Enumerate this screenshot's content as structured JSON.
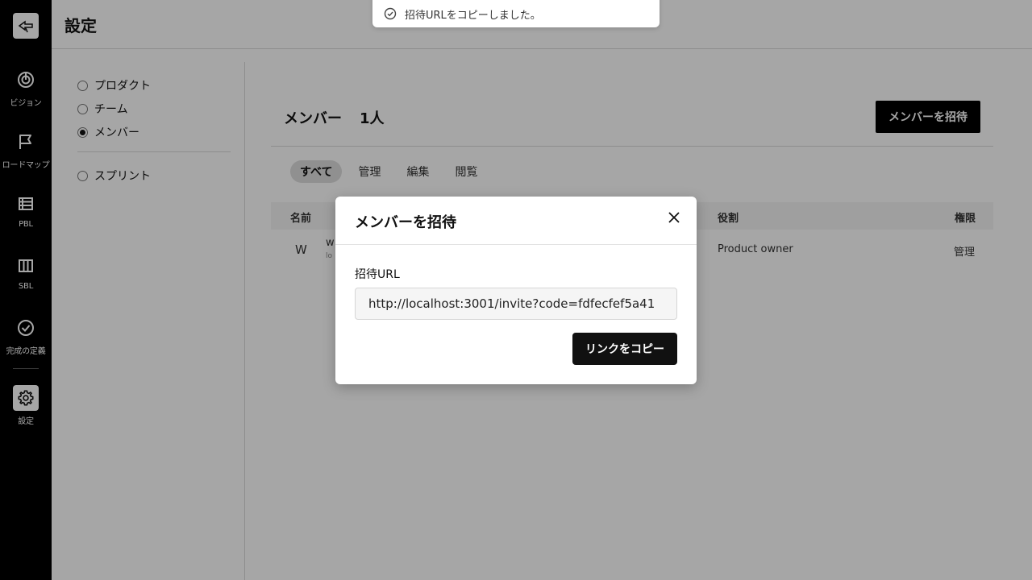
{
  "rail": {
    "items": [
      {
        "label": "ビジョン",
        "icon": "target-icon"
      },
      {
        "label": "ロードマップ",
        "icon": "flag-icon"
      },
      {
        "label": "PBL",
        "icon": "list-icon"
      },
      {
        "label": "SBL",
        "icon": "columns-icon"
      },
      {
        "label": "完成の定義",
        "icon": "check-circle-icon"
      },
      {
        "label": "設定",
        "icon": "gear-icon"
      }
    ]
  },
  "header": {
    "title": "設定"
  },
  "settings_nav": {
    "items": [
      {
        "label": "プロダクト",
        "checked": false
      },
      {
        "label": "チーム",
        "checked": false
      },
      {
        "label": "メンバー",
        "checked": true
      },
      {
        "label": "スプリント",
        "checked": false
      }
    ]
  },
  "members": {
    "title": "メンバー",
    "count": "1人",
    "invite_button": "メンバーを招待",
    "tabs": [
      "すべて",
      "管理",
      "編集",
      "閲覧"
    ],
    "columns": {
      "name": "名前",
      "role": "役割",
      "permission": "権限"
    },
    "rows": [
      {
        "avatar": "W",
        "name": "w",
        "email": "lo",
        "role": "Product owner",
        "permission": "管理"
      }
    ]
  },
  "toast": {
    "message": "招待URLをコピーしました。"
  },
  "modal": {
    "title": "メンバーを招待",
    "field_label": "招待URL",
    "url": "http://localhost:3001/invite?code=fdfecfef5a41",
    "copy_button": "リンクをコピー"
  },
  "colors": {
    "rail": "#000000",
    "overlay": "rgba(0,0,0,0.35)",
    "primary_button": "#111111"
  }
}
